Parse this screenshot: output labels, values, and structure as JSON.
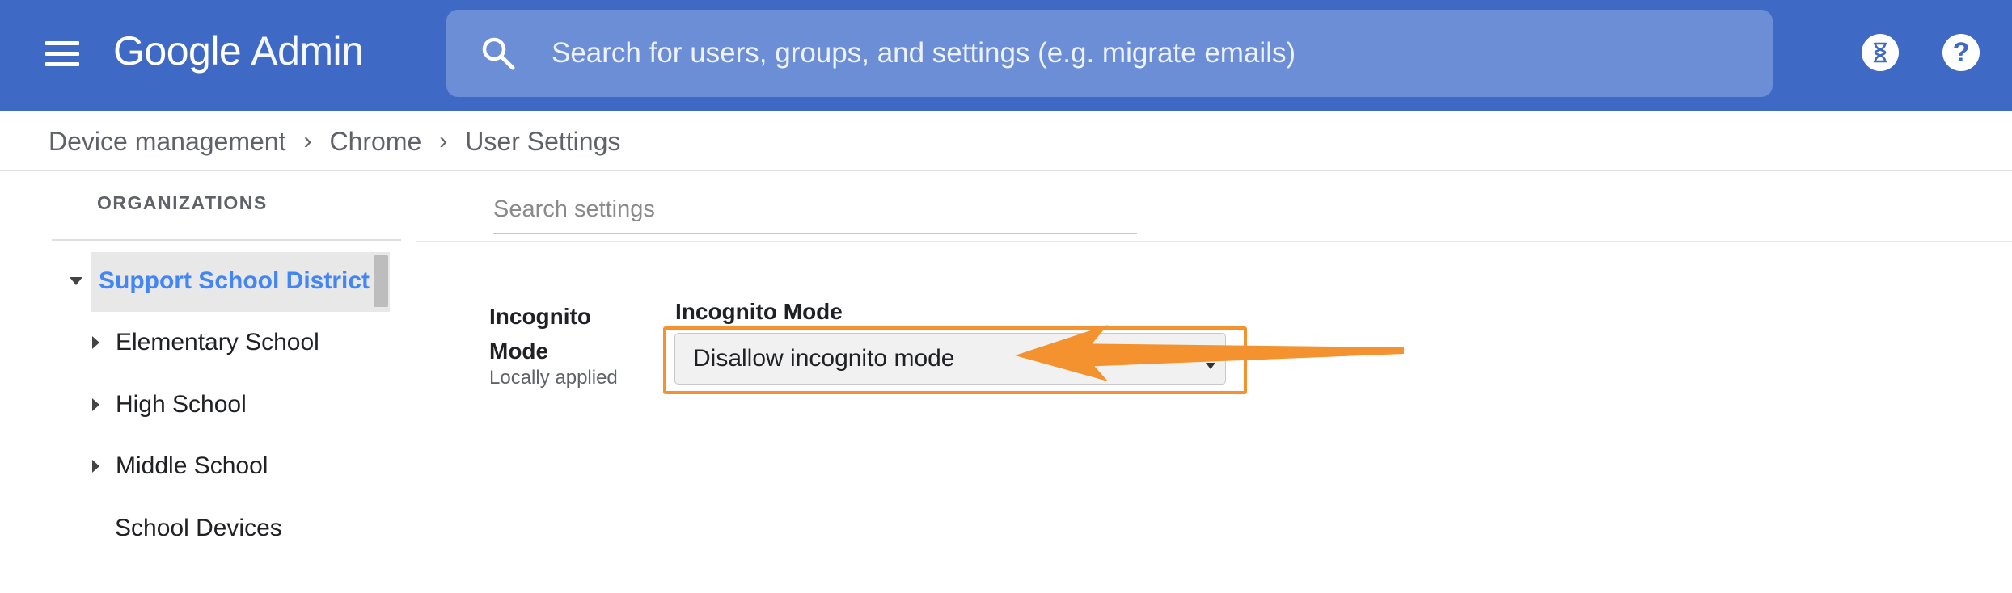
{
  "header": {
    "brand_google": "Google",
    "brand_admin": "Admin",
    "search_placeholder": "Search for users, groups, and settings (e.g. migrate emails)",
    "help_glyph": "?"
  },
  "breadcrumb": {
    "items": [
      "Device management",
      "Chrome",
      "User Settings"
    ],
    "separator": "›"
  },
  "organizations": {
    "heading": "ORGANIZATIONS",
    "root": "Support School District",
    "children": [
      {
        "label": "Elementary School",
        "expandable": true
      },
      {
        "label": "High School",
        "expandable": true
      },
      {
        "label": "Middle School",
        "expandable": true
      },
      {
        "label": "School Devices",
        "expandable": false
      }
    ]
  },
  "settings": {
    "search_placeholder": "Search settings",
    "name_line1": "Incognito",
    "name_line2": "Mode",
    "applied": "Locally applied",
    "field_label": "Incognito Mode",
    "selected_value": "Disallow incognito mode"
  },
  "colors": {
    "header_bg": "#3e6ac6",
    "search_bg": "#6b8ed6",
    "selected_org": "#4285f4",
    "annotation": "#f3922f"
  }
}
